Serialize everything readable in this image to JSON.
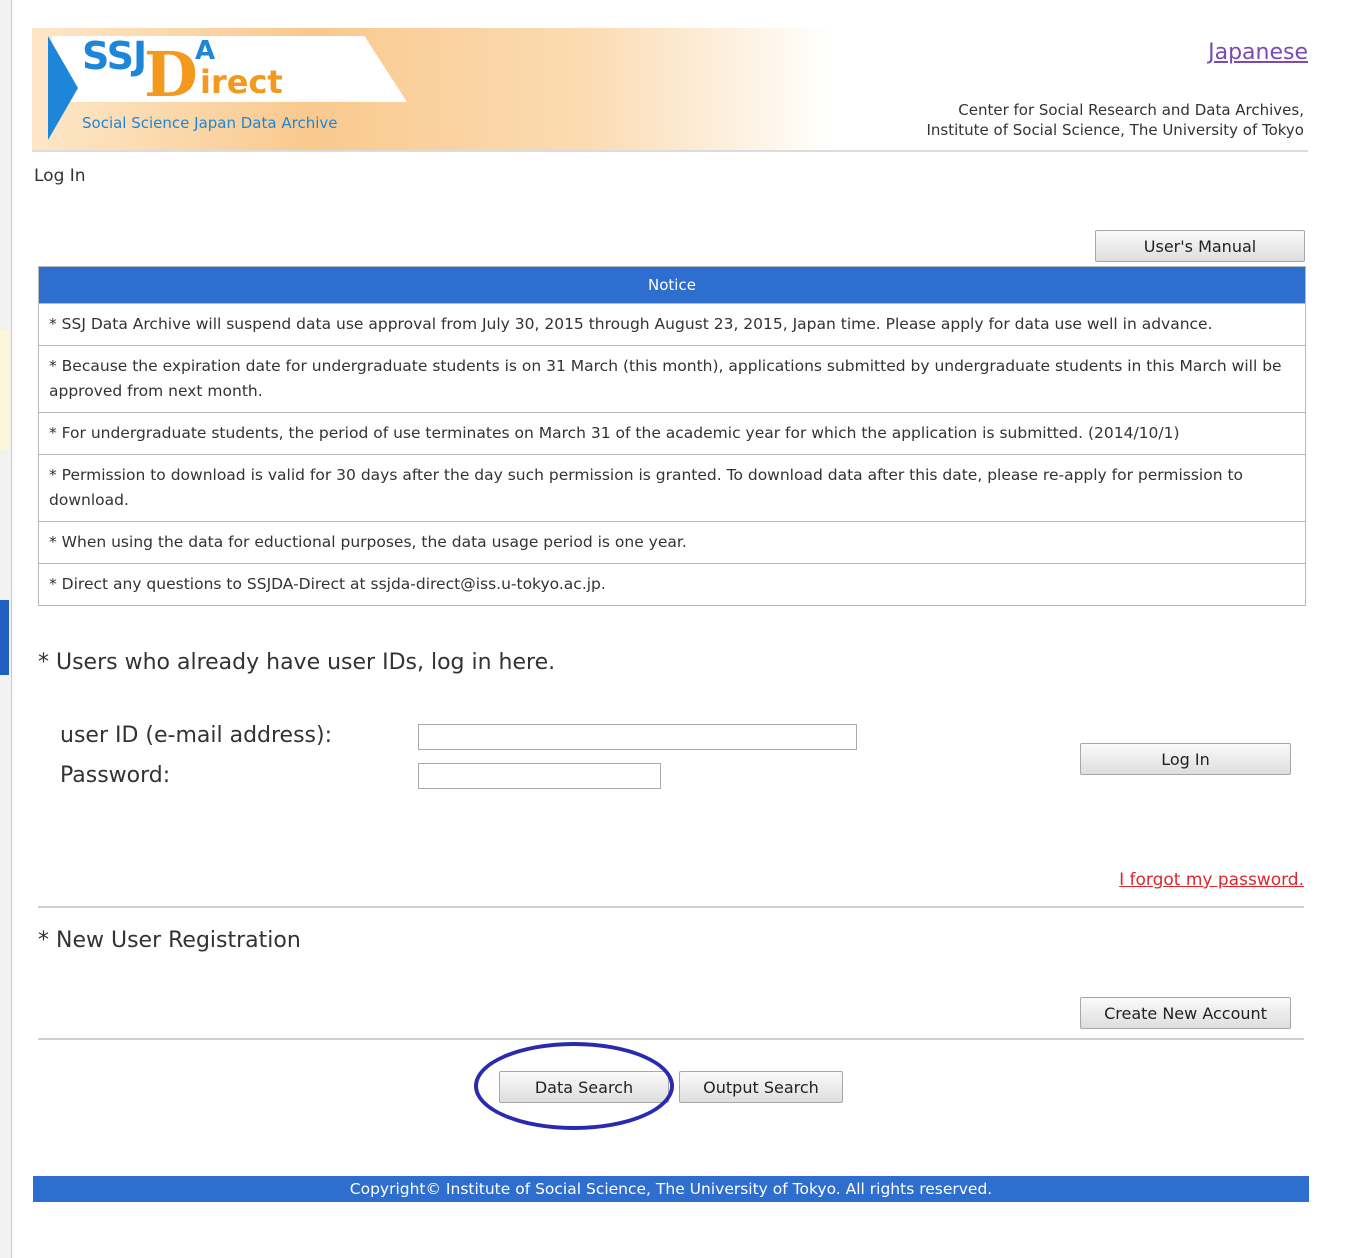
{
  "header": {
    "logo_ssj": "SSJ",
    "logo_a": "A",
    "logo_d": "D",
    "logo_irect": "irect",
    "logo_tagline": "Social Science Japan Data Archive",
    "language_link": "Japanese",
    "center_line1": "Center for Social Research and Data Archives,",
    "center_line2": "Institute of Social Science, The University of Tokyo"
  },
  "breadcrumb": "Log In",
  "users_manual_label": "User's Manual",
  "notice": {
    "title": "Notice",
    "items": [
      "* SSJ Data Archive will suspend data use approval from July 30, 2015 through August 23, 2015, Japan time. Please apply for data use well in advance.",
      "* Because the expiration date for undergraduate students is on 31 March (this month), applications submitted by undergraduate students in this March will be approved from next month.",
      "* For undergraduate students, the period of use terminates on March 31 of the academic year for which the application is submitted. (2014/10/1)",
      "* Permission to download is valid for 30 days after the day such permission is granted. To download data after this date, please re-apply for permission to download.",
      "* When using the data for eductional purposes, the data usage period is one year.",
      "* Direct any questions to SSJDA-Direct at ssjda-direct@iss.u-tokyo.ac.jp."
    ]
  },
  "login": {
    "section_title": "* Users who already have user IDs, log in here.",
    "user_id_label": "user ID (e-mail address):",
    "user_id_value": "",
    "password_label": "Password:",
    "password_value": "",
    "login_button": "Log In",
    "forgot_link": "I forgot my password."
  },
  "registration": {
    "section_title": "* New User Registration",
    "create_button": "Create New Account"
  },
  "search": {
    "data_search": "Data Search",
    "output_search": "Output Search"
  },
  "footer": "Copyright© Institute of Social Science, The University of Tokyo. All rights reserved.",
  "colors": {
    "accent_blue": "#2e6ecf",
    "logo_orange": "#f39a1e",
    "logo_blue": "#1d86d8",
    "link_red": "#e0262d",
    "link_purple": "#7a4bb0",
    "annotation_circle": "#2a2ab0"
  }
}
